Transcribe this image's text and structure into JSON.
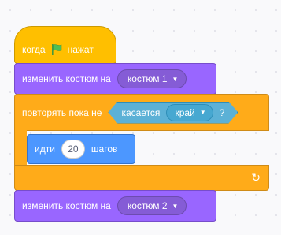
{
  "event_block": {
    "when_label": "когда",
    "flag_icon": "green-flag-icon",
    "clicked_label": "нажат"
  },
  "looks_block_1": {
    "label": "изменить костюм на",
    "costume": "костюм 1"
  },
  "repeat_block": {
    "label": "повторять пока не",
    "condition": {
      "label": "касается",
      "target": "край",
      "question": "?"
    }
  },
  "move_block": {
    "label": "идти",
    "steps": "20",
    "unit": "шагов"
  },
  "looks_block_2": {
    "label": "изменить костюм на",
    "costume": "костюм 2"
  },
  "icons": {
    "loop_arrow": "loop-arrow-icon",
    "dropdown": "caret-down-icon"
  },
  "colors": {
    "events": "#ffbf00",
    "looks": "#9966ff",
    "control": "#ffab19",
    "motion": "#4c97ff",
    "sensing": "#5cb1d6"
  }
}
